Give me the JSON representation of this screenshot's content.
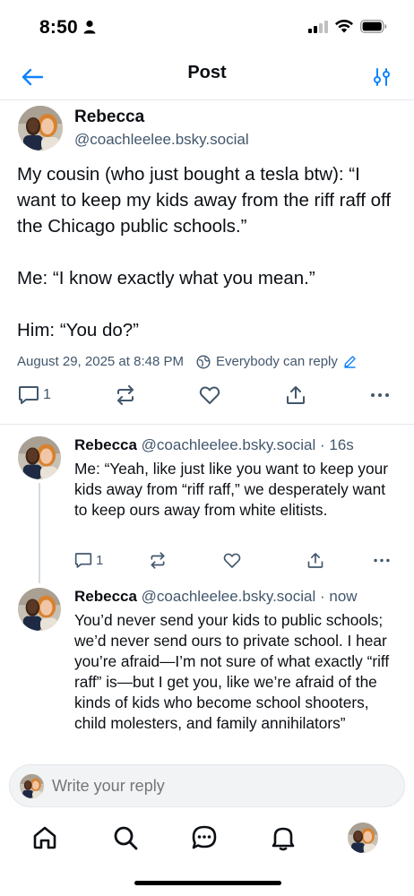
{
  "status_bar": {
    "time": "8:50"
  },
  "header": {
    "title": "Post"
  },
  "main_post": {
    "author_name": "Rebecca",
    "handle": "@coachleelee.bsky.social",
    "text": "My cousin (who just bought a tesla btw): “I want to keep my kids away from the riff raff off the Chicago public schools.”\n\nMe: “I know exactly what you mean.”\n\nHim: “You do?”",
    "timestamp": "August 29, 2025 at 8:48 PM",
    "reply_setting": "Everybody can reply",
    "reply_count": "1"
  },
  "replies": [
    {
      "author_name": "Rebecca",
      "handle": "@coachleelee.bsky.social",
      "time": "· 16s",
      "text": "Me: “Yeah, like just like you want to keep your kids away from “riff raff,” we desperately want to keep ours away from white elitists.",
      "reply_count": "1"
    },
    {
      "author_name": "Rebecca",
      "handle": "@coachleelee.bsky.social",
      "time": "· now",
      "text": "You’d never send your kids to public schools; we’d never send ours to private school. I hear you’re afraid—I’m not sure of what exactly “riff raff” is—but I get you, like we’re afraid of the kinds of kids who become school shooters, child molesters, and family annihilators”"
    }
  ],
  "composer": {
    "placeholder": "Write your reply"
  },
  "tabs": [
    "home-icon",
    "search-icon",
    "chat-icon",
    "bell-icon",
    "profile-avatar"
  ],
  "colors": {
    "text": "#0b0f14",
    "muted": "#42576c",
    "accent": "#1083fe",
    "divider": "#e3e7ec"
  }
}
